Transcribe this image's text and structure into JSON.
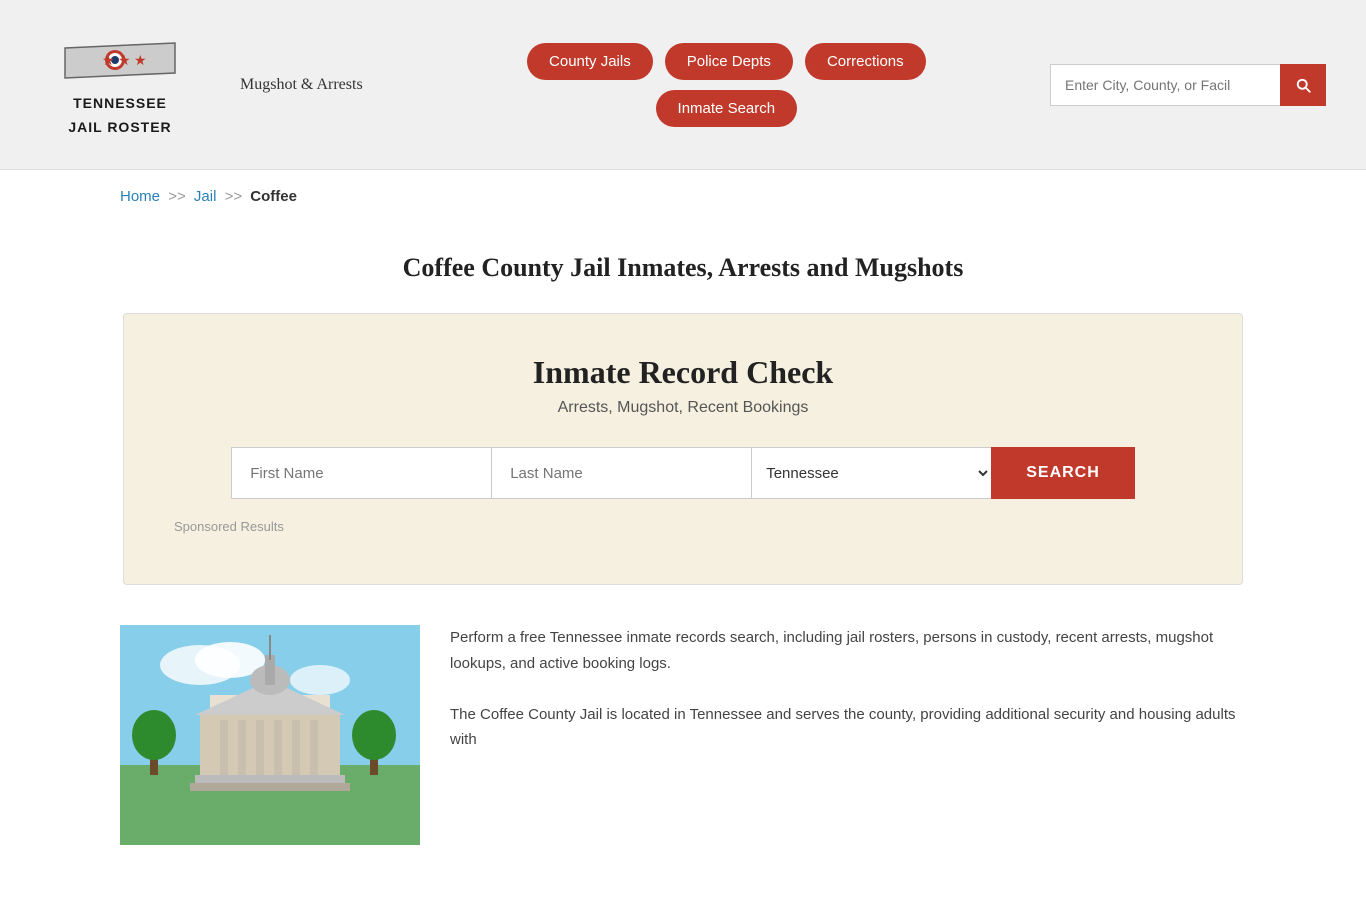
{
  "header": {
    "logo_line1": "TENNESSEE",
    "logo_line2": "JAIL ROSTER",
    "mugshot_link": "Mugshot & Arrests",
    "nav_buttons": [
      {
        "label": "County Jails",
        "id": "county-jails"
      },
      {
        "label": "Police Depts",
        "id": "police-depts"
      },
      {
        "label": "Corrections",
        "id": "corrections"
      },
      {
        "label": "Inmate Search",
        "id": "inmate-search"
      }
    ],
    "search_placeholder": "Enter City, County, or Facil"
  },
  "breadcrumb": {
    "home": "Home",
    "sep1": ">>",
    "jail": "Jail",
    "sep2": ">>",
    "current": "Coffee"
  },
  "page": {
    "title": "Coffee County Jail Inmates, Arrests and Mugshots"
  },
  "record_check": {
    "heading": "Inmate Record Check",
    "subtitle": "Arrests, Mugshot, Recent Bookings",
    "first_name_placeholder": "First Name",
    "last_name_placeholder": "Last Name",
    "state_default": "Tennessee",
    "search_button": "SEARCH",
    "sponsored_label": "Sponsored Results"
  },
  "content": {
    "paragraph1": "Perform a free Tennessee inmate records search, including jail rosters, persons in custody, recent arrests, mugshot lookups, and active booking logs.",
    "paragraph2": "The Coffee County Jail is located in Tennessee and serves the county, providing additional security and housing adults with"
  }
}
